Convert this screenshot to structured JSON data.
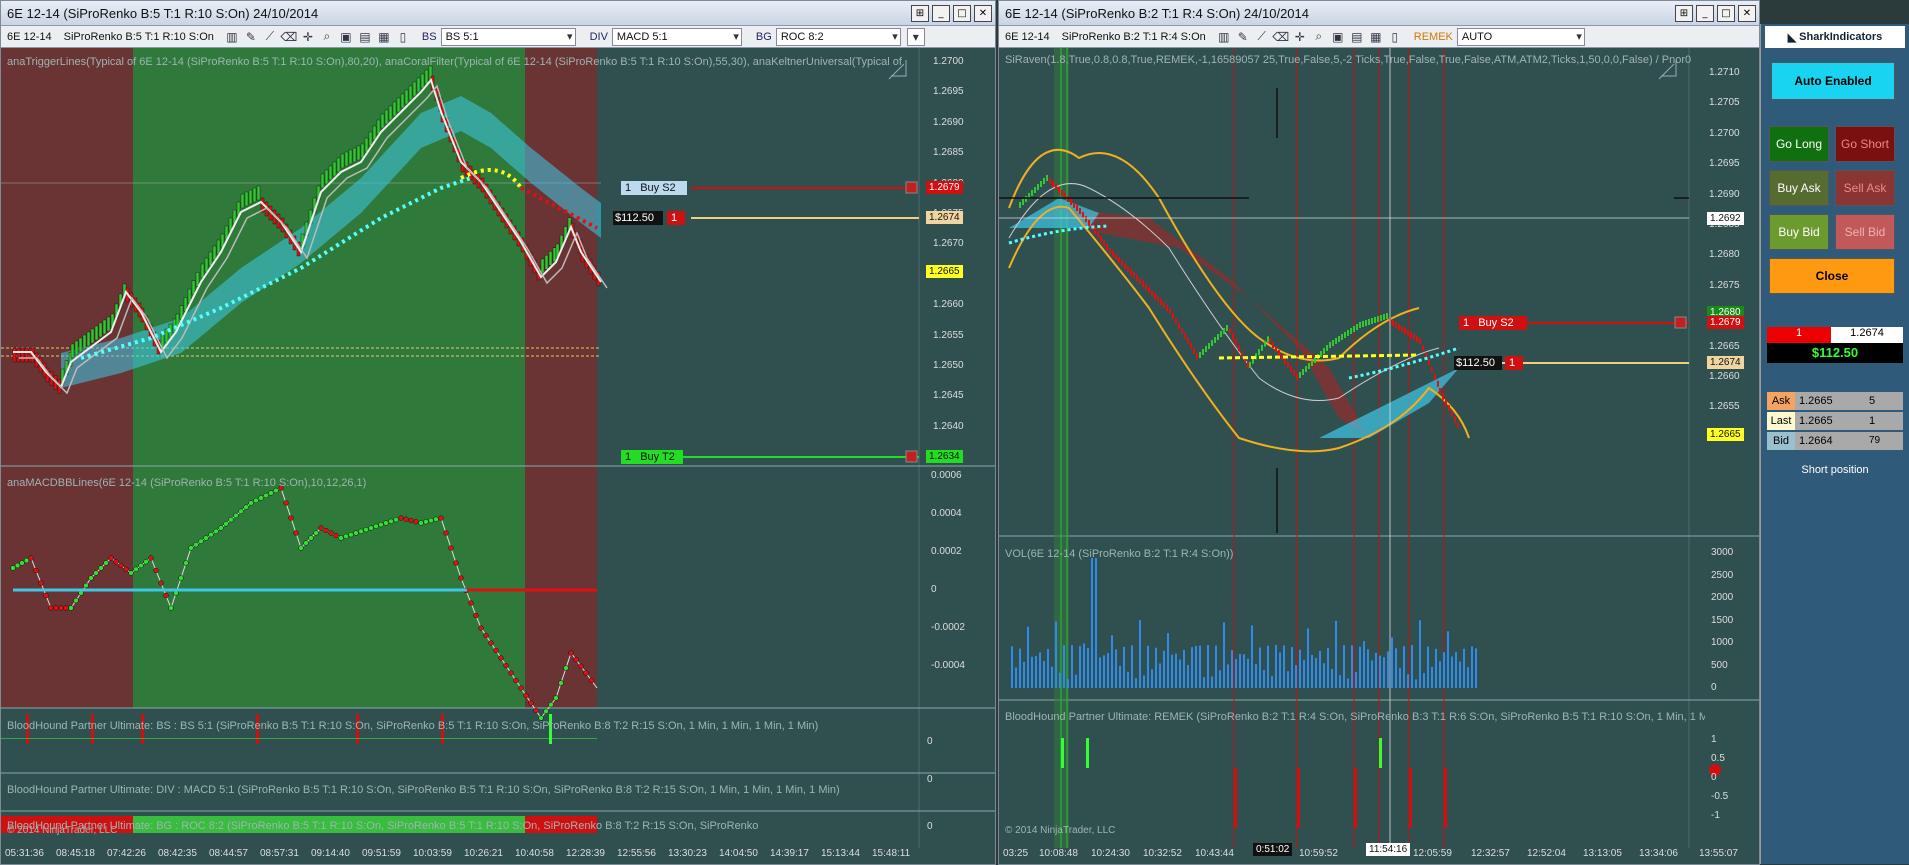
{
  "left": {
    "title": "6E 12-14 (SiProRenko B:5 T:1 R:10 S:On)  24/10/2014",
    "instrument": "6E 12-14",
    "series": "SiProRenko B:5 T:1 R:10 S:On",
    "bs_label": "BS",
    "bs_value": "BS 5:1",
    "div_label": "DIV",
    "div_value": "MACD 5:1",
    "bg_label": "BG",
    "bg_value": "ROC 8:2",
    "indicator1": "anaTriggerLines(Typical of 6E 12-14 (SiProRenko B:5 T:1 R:10 S:On),80,20), anaCoralFilter(Typical of 6E 12-14 (SiProRenko B:5 T:1 R:10 S:On),55,30), anaKeltnerUniversal(Typical of",
    "indicator2": "anaMACDBBLines(6E 12-14 (SiProRenko B:5 T:1 R:10 S:On),10,12,26,1)",
    "indicator3": "BloodHound Partner Ultimate: BS : BS 5:1 (SiProRenko B:5 T:1 R:10 S:On, SiProRenko B:5 T:1 R:10 S:On, SiProRenko B:8 T:2 R:15 S:On, 1 Min, 1 Min, 1 Min, 1 Min)",
    "indicator4": "BloodHound Partner Ultimate: DIV : MACD 5:1 (SiProRenko B:5 T:1 R:10 S:On, SiProRenko B:5 T:1 R:10 S:On, SiProRenko B:8 T:2 R:15 S:On, 1 Min, 1 Min, 1 Min, 1 Min)",
    "indicator5": "BloodHound Partner Ultimate: BG : ROC 8:2 (SiProRenko B:5 T:1 R:10 S:On, SiProRenko B:5 T:1 R:10 S:On, SiProRenko B:8 T:2 R:15 S:On, SiProRenko",
    "copyright": "© 2014 NinjaTrader, LLC",
    "price_axis": [
      "1.2700",
      "1.2695",
      "1.2690",
      "1.2685",
      "1.2680",
      "1.2675",
      "1.2670",
      "1.2665",
      "1.2660",
      "1.2655",
      "1.2650",
      "1.2645",
      "1.2640",
      "1.2635"
    ],
    "macd_axis": [
      "0.0006",
      "0.0004",
      "0.0002",
      "0",
      "-0.0002",
      "-0.0004"
    ],
    "zero": "0",
    "time_axis": [
      "05:31:36",
      "08:45:18",
      "07:42:26",
      "08:42:35",
      "08:44:57",
      "08:57:31",
      "09:14:40",
      "09:51:59",
      "10:03:59",
      "10:26:21",
      "10:40:58",
      "12:28:39",
      "12:55:56",
      "13:30:23",
      "14:04:50",
      "14:39:17",
      "15:13:44",
      "15:48:11"
    ],
    "buy_s2": {
      "qty": "1",
      "label": "Buy S2",
      "price": "1.2679"
    },
    "position": {
      "pnl": "$112.50",
      "qty": "1",
      "price": "1.2674"
    },
    "buy_t2": {
      "qty": "1",
      "label": "Buy T2",
      "price": "1.2634"
    },
    "last_price": "1.2665"
  },
  "right": {
    "title": "6E 12-14 (SiProRenko B:2 T:1 R:4 S:On)  24/10/2014",
    "instrument": "6E 12-14",
    "series": "SiProRenko B:2 T:1 R:4 S:On",
    "remek_label": "REMEK",
    "remek_value": "AUTO",
    "indicator1": "SiRaven(1.8,True,0.8,0.8,True,REMEK,-1,16589057 25,True,False,5,-2 Ticks,True,False,True,False,ATM,ATM2,Ticks,1,50,0,0,False) / Pnor0",
    "indicator2": "VOL(6E 12-14 (SiProRenko B:2 T:1 R:4 S:On))",
    "indicator3": "BloodHound Partner Ultimate: REMEK (SiProRenko B:2 T:1 R:4 S:On, SiProRenko B:3 T:1 R:6 S:On, SiProRenko B:5 T:1 R:10 S:On, 1 Min, 1 Mi",
    "copyright": "© 2014 NinjaTrader, LLC",
    "price_axis": [
      "1.2710",
      "1.2705",
      "1.2700",
      "1.2695",
      "1.2690",
      "1.2685",
      "1.2680",
      "1.2675",
      "1.2670",
      "1.2665",
      "1.2660",
      "1.2655"
    ],
    "vol_axis": [
      "3000",
      "2500",
      "2000",
      "1500",
      "1000",
      "500",
      "0"
    ],
    "bh_axis": [
      "1",
      "0.5",
      "0",
      "-0.5",
      "-1"
    ],
    "time_axis": [
      "03:25",
      "10:08:48",
      "10:24:30",
      "10:32:52",
      "10:43:44",
      "10:51:02",
      "10:59:52",
      "11:54:16",
      "12:05:59",
      "12:32:57",
      "12:52:04",
      "13:13:05",
      "13:34:06",
      "13:55:07"
    ],
    "crosshair_price": "1.2692",
    "crosshair_time": "11:54:16",
    "time_marker": "0:51:02",
    "price_1_2680": "1.2680",
    "buy_s2": {
      "qty": "1",
      "label": "Buy S2",
      "price": "1.2679"
    },
    "position": {
      "pnl": "$112.50",
      "qty": "1",
      "price": "1.2674"
    },
    "last_price": "1.2665"
  },
  "panel": {
    "brand": "SharkIndicators",
    "auto": "Auto Enabled",
    "go_long": "Go Long",
    "go_short": "Go Short",
    "buy_ask": "Buy Ask",
    "sell_ask": "Sell Ask",
    "buy_bid": "Buy Bid",
    "sell_bid": "Sell Bid",
    "close": "Close",
    "qty": "1",
    "entry": "1.2674",
    "pnl": "$112.50",
    "ask_label": "Ask",
    "ask_price": "1.2665",
    "ask_size": "5",
    "last_label": "Last",
    "last_price": "1.2665",
    "last_size": "1",
    "bid_label": "Bid",
    "bid_price": "1.2664",
    "bid_size": "79",
    "position_text": "Short position"
  },
  "colors": {
    "bg": "#305050",
    "green_zone": "#2f7a3a",
    "red_zone": "#6a3434",
    "up": "#32c832",
    "down": "#e01010",
    "cyan": "#3ec8e8"
  }
}
